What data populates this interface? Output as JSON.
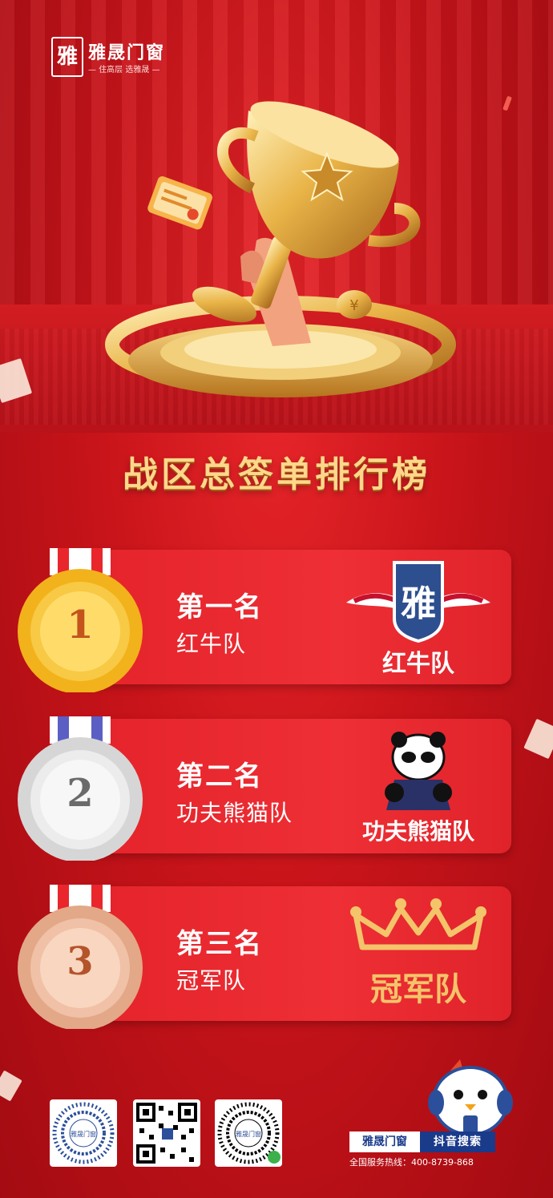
{
  "brand": {
    "mark": "雅",
    "name": "雅晟门窗",
    "slogan": "— 住高层 选雅晟 —"
  },
  "title": "战区总签单排行榜",
  "rankings": [
    {
      "rank_label": "第一名",
      "team": "红牛队",
      "medal_number": "1",
      "team_logo_text": "红牛队"
    },
    {
      "rank_label": "第二名",
      "team": "功夫熊猫队",
      "medal_number": "2",
      "team_logo_text": "功夫熊猫队"
    },
    {
      "rank_label": "第三名",
      "team": "冠军队",
      "medal_number": "3",
      "team_logo_text": "冠军队"
    }
  ],
  "footer": {
    "qr_center_label_1": "雅晟门窗",
    "qr_center_label_3": "雅晟门窗",
    "brand_tag": "雅晟门窗",
    "search_tag": "抖音搜索",
    "hotline": "全国服务热线：400-8739-868"
  },
  "colors": {
    "background": "#c8141a",
    "card": "#e8262d",
    "title_gold": "#ffd78a",
    "gold_medal": "#f2b21b",
    "silver_medal": "#cfcfcf",
    "bronze_medal": "#e8b08f",
    "footer_blue": "#1a3a8a"
  }
}
